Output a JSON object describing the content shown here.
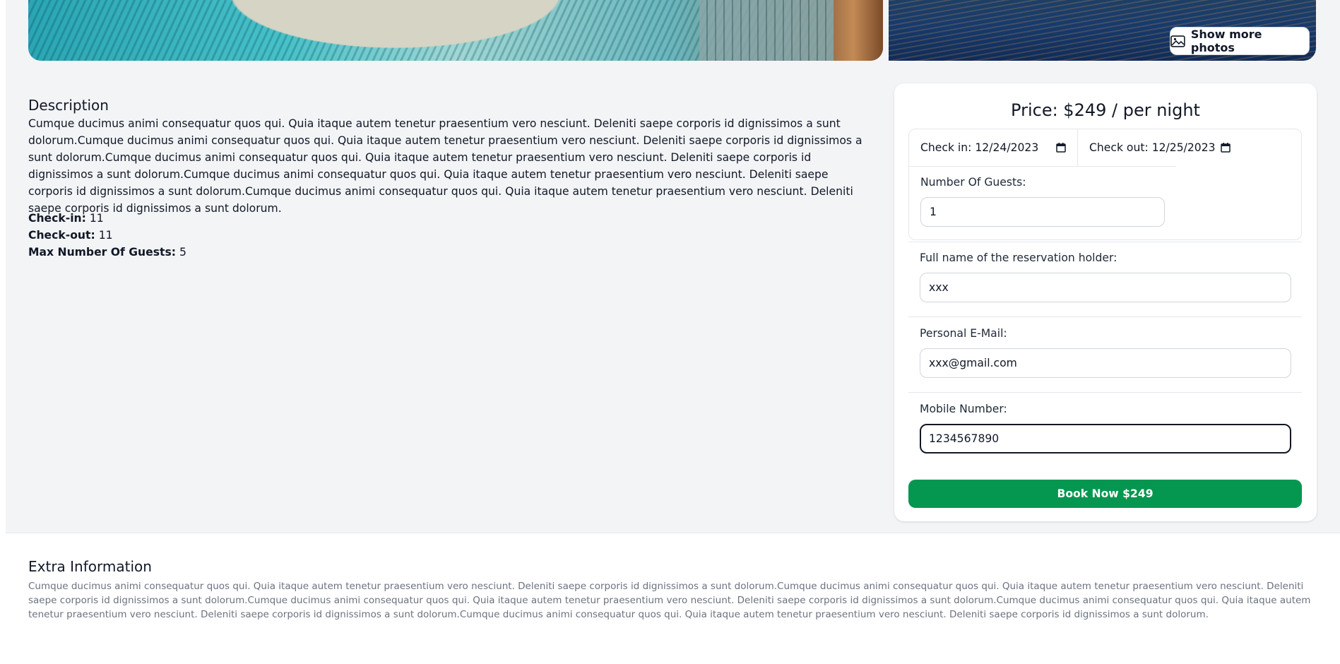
{
  "gallery": {
    "show_more_label": "Show more photos",
    "icon": "image-icon"
  },
  "description": {
    "title": "Description",
    "text": "Cumque ducimus animi consequatur quos qui. Quia itaque autem tenetur praesentium vero nesciunt. Deleniti saepe corporis id dignissimos a sunt dolorum.Cumque ducimus animi consequatur quos qui. Quia itaque autem tenetur praesentium vero nesciunt. Deleniti saepe corporis id dignissimos a sunt dolorum.Cumque ducimus animi consequatur quos qui. Quia itaque autem tenetur praesentium vero nesciunt. Deleniti saepe corporis id dignissimos a sunt dolorum.Cumque ducimus animi consequatur quos qui. Quia itaque autem tenetur praesentium vero nesciunt. Deleniti saepe corporis id dignissimos a sunt dolorum.Cumque ducimus animi consequatur quos qui. Quia itaque autem tenetur praesentium vero nesciunt. Deleniti saepe corporis id dignissimos a sunt dolorum."
  },
  "details": [
    {
      "label": "Check-in:",
      "value": "11"
    },
    {
      "label": "Check-out:",
      "value": "11"
    },
    {
      "label": "Max Number Of Guests:",
      "value": "5"
    }
  ],
  "booking": {
    "price_label": "Price: $249 / per night",
    "check_in_label": "Check in:",
    "check_in_value": "12/24/2023",
    "check_out_label": "Check out:",
    "check_out_value": "12/25/2023",
    "guests_label": "Number Of Guests:",
    "guests_value": "1",
    "full_name_label": "Full name of the reservation holder:",
    "full_name_value": "xxx",
    "email_label": "Personal E-Mail:",
    "email_value": "xxx@gmail.com",
    "mobile_label": "Mobile Number:",
    "mobile_value": "1234567890",
    "book_button": "Book Now $249",
    "accent_color": "#059650"
  },
  "extra": {
    "title": "Extra Information",
    "text": "Cumque ducimus animi consequatur quos qui. Quia itaque autem tenetur praesentium vero nesciunt. Deleniti saepe corporis id dignissimos a sunt dolorum.Cumque ducimus animi consequatur quos qui. Quia itaque autem tenetur praesentium vero nesciunt. Deleniti saepe corporis id dignissimos a sunt dolorum.Cumque ducimus animi consequatur quos qui. Quia itaque autem tenetur praesentium vero nesciunt. Deleniti saepe corporis id dignissimos a sunt dolorum.Cumque ducimus animi consequatur quos qui. Quia itaque autem tenetur praesentium vero nesciunt. Deleniti saepe corporis id dignissimos a sunt dolorum.Cumque ducimus animi consequatur quos qui. Quia itaque autem tenetur praesentium vero nesciunt. Deleniti saepe corporis id dignissimos a sunt dolorum."
  }
}
